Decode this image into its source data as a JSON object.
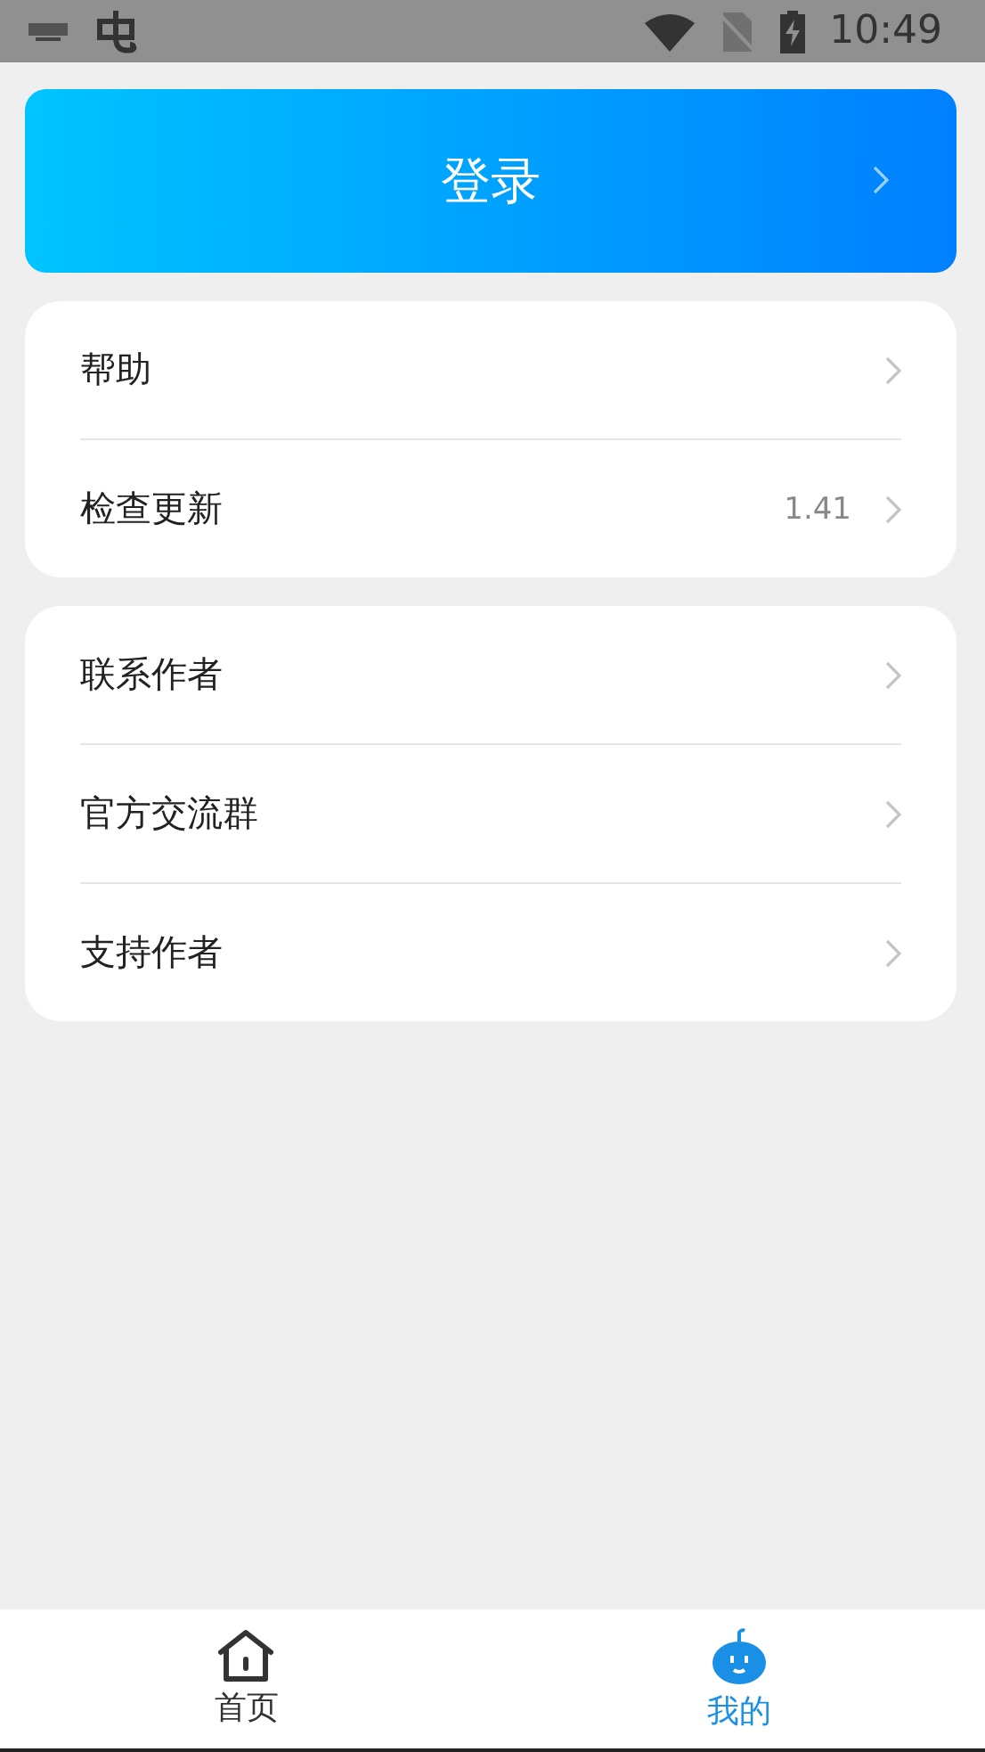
{
  "status_bar": {
    "time": "10:49"
  },
  "login": {
    "label": "登录"
  },
  "menu_groups": [
    {
      "items": [
        {
          "label": "帮助"
        },
        {
          "label": "检查更新",
          "value": "1.41"
        }
      ]
    },
    {
      "items": [
        {
          "label": "联系作者"
        },
        {
          "label": "官方交流群"
        },
        {
          "label": "支持作者"
        }
      ]
    }
  ],
  "bottom_nav": [
    {
      "label": "首页",
      "kind": "home",
      "selected": false
    },
    {
      "label": "我的",
      "kind": "robot",
      "selected": true
    }
  ]
}
